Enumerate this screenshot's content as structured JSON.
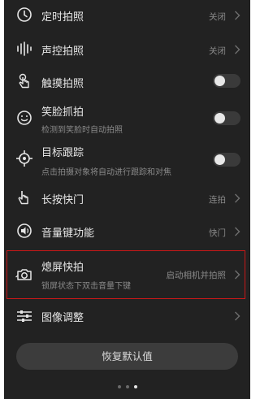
{
  "settings": [
    {
      "title": "定时拍照",
      "subtitle": "",
      "value": "关闭",
      "icon": "clock-icon",
      "control": "chevron"
    },
    {
      "title": "声控拍照",
      "subtitle": "",
      "value": "关闭",
      "icon": "sound-wave-icon",
      "control": "chevron"
    },
    {
      "title": "触摸拍照",
      "subtitle": "",
      "value": "",
      "icon": "touch-icon",
      "control": "toggle",
      "on": false
    },
    {
      "title": "笑脸抓拍",
      "subtitle": "检测到笑脸时自动拍照",
      "value": "",
      "icon": "smile-icon",
      "control": "toggle",
      "on": false
    },
    {
      "title": "目标跟踪",
      "subtitle": "点击拍摄对象将自动进行跟踪和对焦",
      "value": "",
      "icon": "target-icon",
      "control": "toggle",
      "on": false
    },
    {
      "title": "长按快门",
      "subtitle": "",
      "value": "连拍",
      "icon": "long-press-icon",
      "control": "chevron"
    },
    {
      "title": "音量键功能",
      "subtitle": "",
      "value": "快门",
      "icon": "volume-icon",
      "control": "chevron"
    },
    {
      "title": "熄屏快拍",
      "subtitle": "锁屏状态下双击音量下键",
      "value": "启动相机并拍照",
      "icon": "camera-snap-icon",
      "control": "chevron"
    },
    {
      "title": "图像调整",
      "subtitle": "",
      "value": "",
      "icon": "sliders-icon",
      "control": "chevron"
    }
  ],
  "reset_button": {
    "label": "恢复默认值"
  },
  "pager": {
    "total": 3,
    "active": 3
  },
  "colors": {
    "background": "#222222",
    "highlight": "#c81818",
    "text": "#e6e6e6",
    "secondary": "#8a8a8a"
  }
}
